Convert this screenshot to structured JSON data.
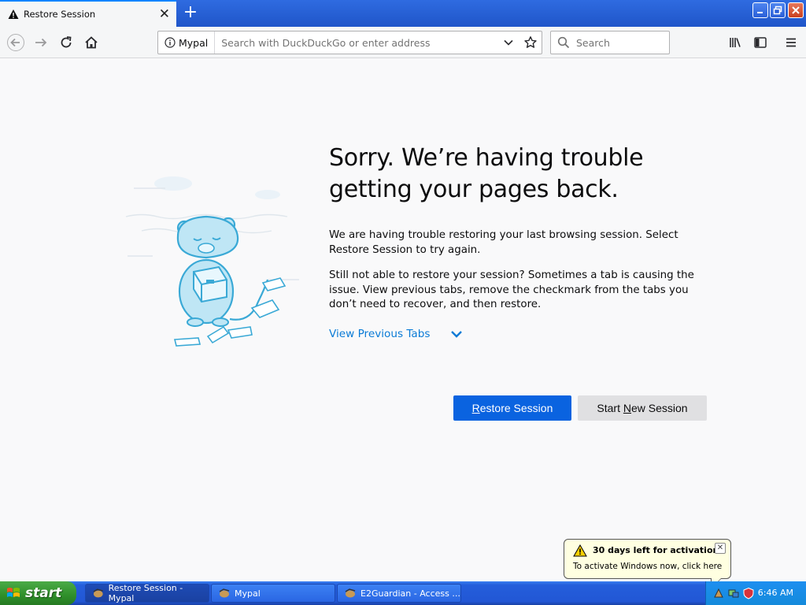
{
  "browser": {
    "tab_title": "Restore Session",
    "site_identity": "Mypal",
    "url_placeholder": "Search with DuckDuckGo or enter address",
    "search_placeholder": "Search"
  },
  "page": {
    "heading": "Sorry. We’re having trouble getting your pages back.",
    "paragraph1": "We are having trouble restoring your last browsing session. Select Restore Session to try again.",
    "paragraph2": "Still not able to restore your session? Sometimes a tab is causing the issue. View previous tabs, remove the checkmark from the tabs you don’t need to recover, and then restore.",
    "view_previous_tabs": "View Previous Tabs",
    "restore_button_first": "R",
    "restore_button_rest": "estore Session",
    "new_session_prefix": "Start ",
    "new_session_underlined": "N",
    "new_session_rest": "ew Session"
  },
  "balloon": {
    "title": "30 days left for activation",
    "text": "To activate Windows now, click here"
  },
  "taskbar": {
    "start_label": "start",
    "tasks": [
      {
        "label": "Restore Session - Mypal"
      },
      {
        "label": "Mypal"
      },
      {
        "label": "E2Guardian - Access ..."
      }
    ],
    "clock": "6:46 AM"
  },
  "colors": {
    "accent": "#0a63e0",
    "link": "#0a7bd6",
    "taskbar": "#245edb",
    "start": "#2f8f2a"
  }
}
